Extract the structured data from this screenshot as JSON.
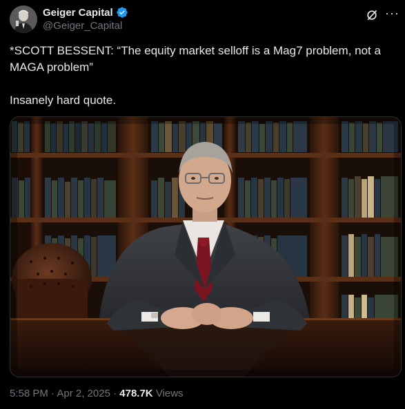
{
  "author": {
    "display_name": "Geiger Capital",
    "handle": "@Geiger_Capital",
    "verified": true,
    "avatar_icon": "portrait-avatar"
  },
  "header_icons": {
    "grok": "grok-icon",
    "more": "more-icon"
  },
  "post": {
    "line1": "*SCOTT BESSENT: “The equity market selloff is a Mag7 problem, not a MAGA problem”",
    "line2": "Insanely hard quote."
  },
  "media": {
    "type": "photo",
    "subject": "man in suit with glasses at desk in library"
  },
  "meta": {
    "timestamp": "5:58 PM · Apr 2, 2025",
    "separator": " · ",
    "views_count": "478.7K",
    "views_label": "Views"
  },
  "colors": {
    "background": "#000000",
    "text_primary": "#e7e9ea",
    "text_secondary": "#71767b",
    "verified_blue": "#1d9bf0"
  }
}
